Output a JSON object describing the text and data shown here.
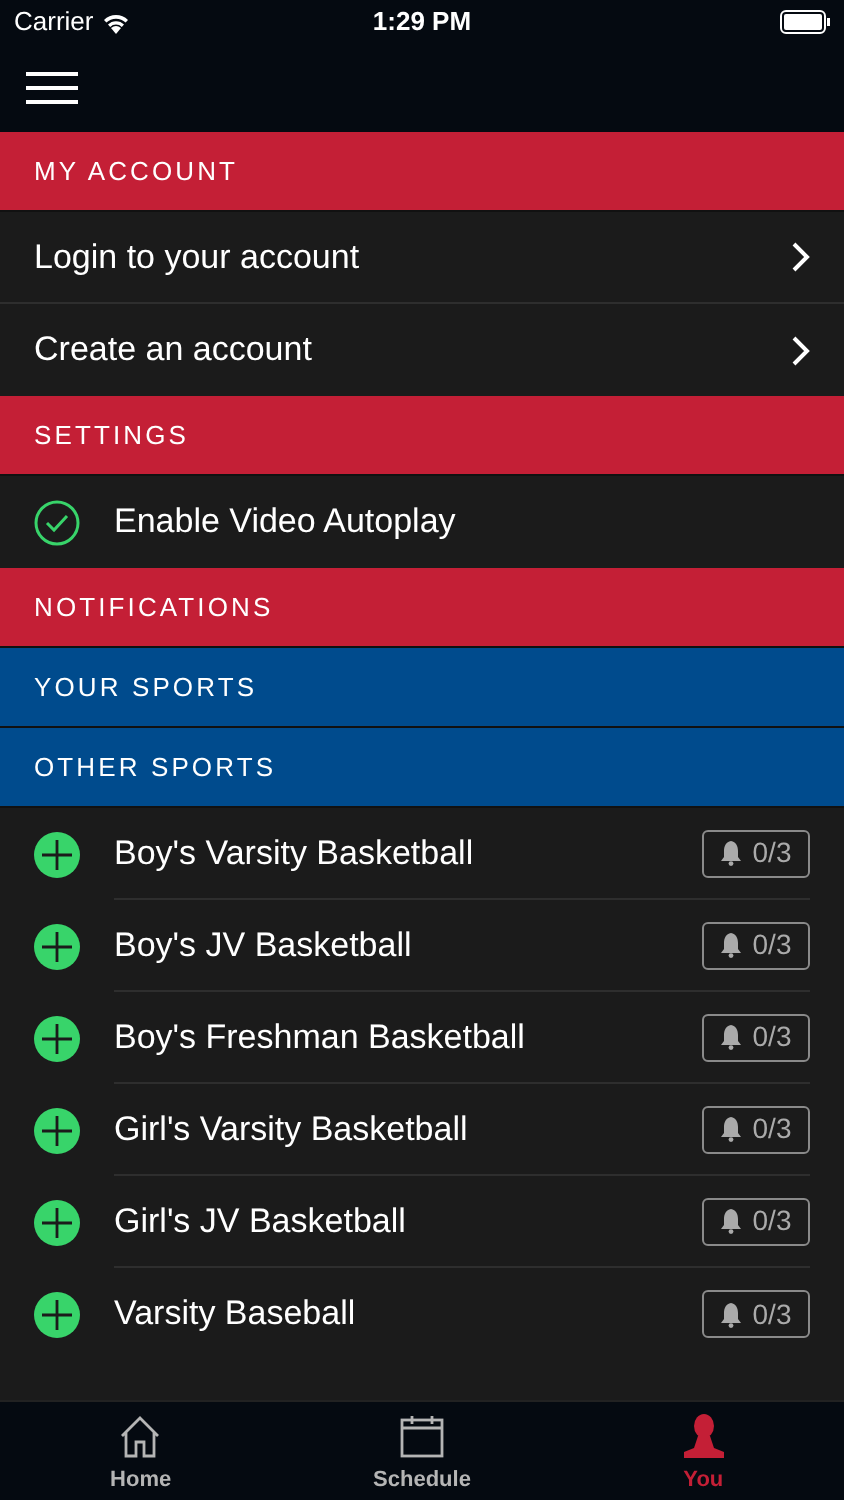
{
  "status_bar": {
    "carrier": "Carrier",
    "time": "1:29 PM"
  },
  "sections": [
    {
      "title": "MY ACCOUNT",
      "color": "#c41f36",
      "kind": "links",
      "items": [
        {
          "label": "Login to your account"
        },
        {
          "label": "Create an account"
        }
      ]
    },
    {
      "title": "SETTINGS",
      "color": "#c41f36",
      "kind": "toggles",
      "items": [
        {
          "label": "Enable Video Autoplay",
          "checked": true
        }
      ]
    },
    {
      "title": "NOTIFICATIONS",
      "color": "#c41f36"
    },
    {
      "title": "YOUR SPORTS",
      "color": "#004b8d"
    },
    {
      "title": "OTHER SPORTS",
      "color": "#004b8d",
      "kind": "sports",
      "items": [
        {
          "label": "Boy's Varsity Basketball",
          "count": "0/3"
        },
        {
          "label": "Boy's JV Basketball",
          "count": "0/3"
        },
        {
          "label": "Boy's Freshman Basketball",
          "count": "0/3"
        },
        {
          "label": "Girl's Varsity Basketball",
          "count": "0/3"
        },
        {
          "label": "Girl's JV Basketball",
          "count": "0/3"
        },
        {
          "label": "Varsity Baseball",
          "count": "0/3"
        }
      ]
    }
  ],
  "tabs": [
    {
      "label": "Home",
      "kind": "home",
      "selected": false
    },
    {
      "label": "Schedule",
      "kind": "schedule",
      "selected": false
    },
    {
      "label": "You",
      "kind": "person",
      "selected": true
    }
  ]
}
